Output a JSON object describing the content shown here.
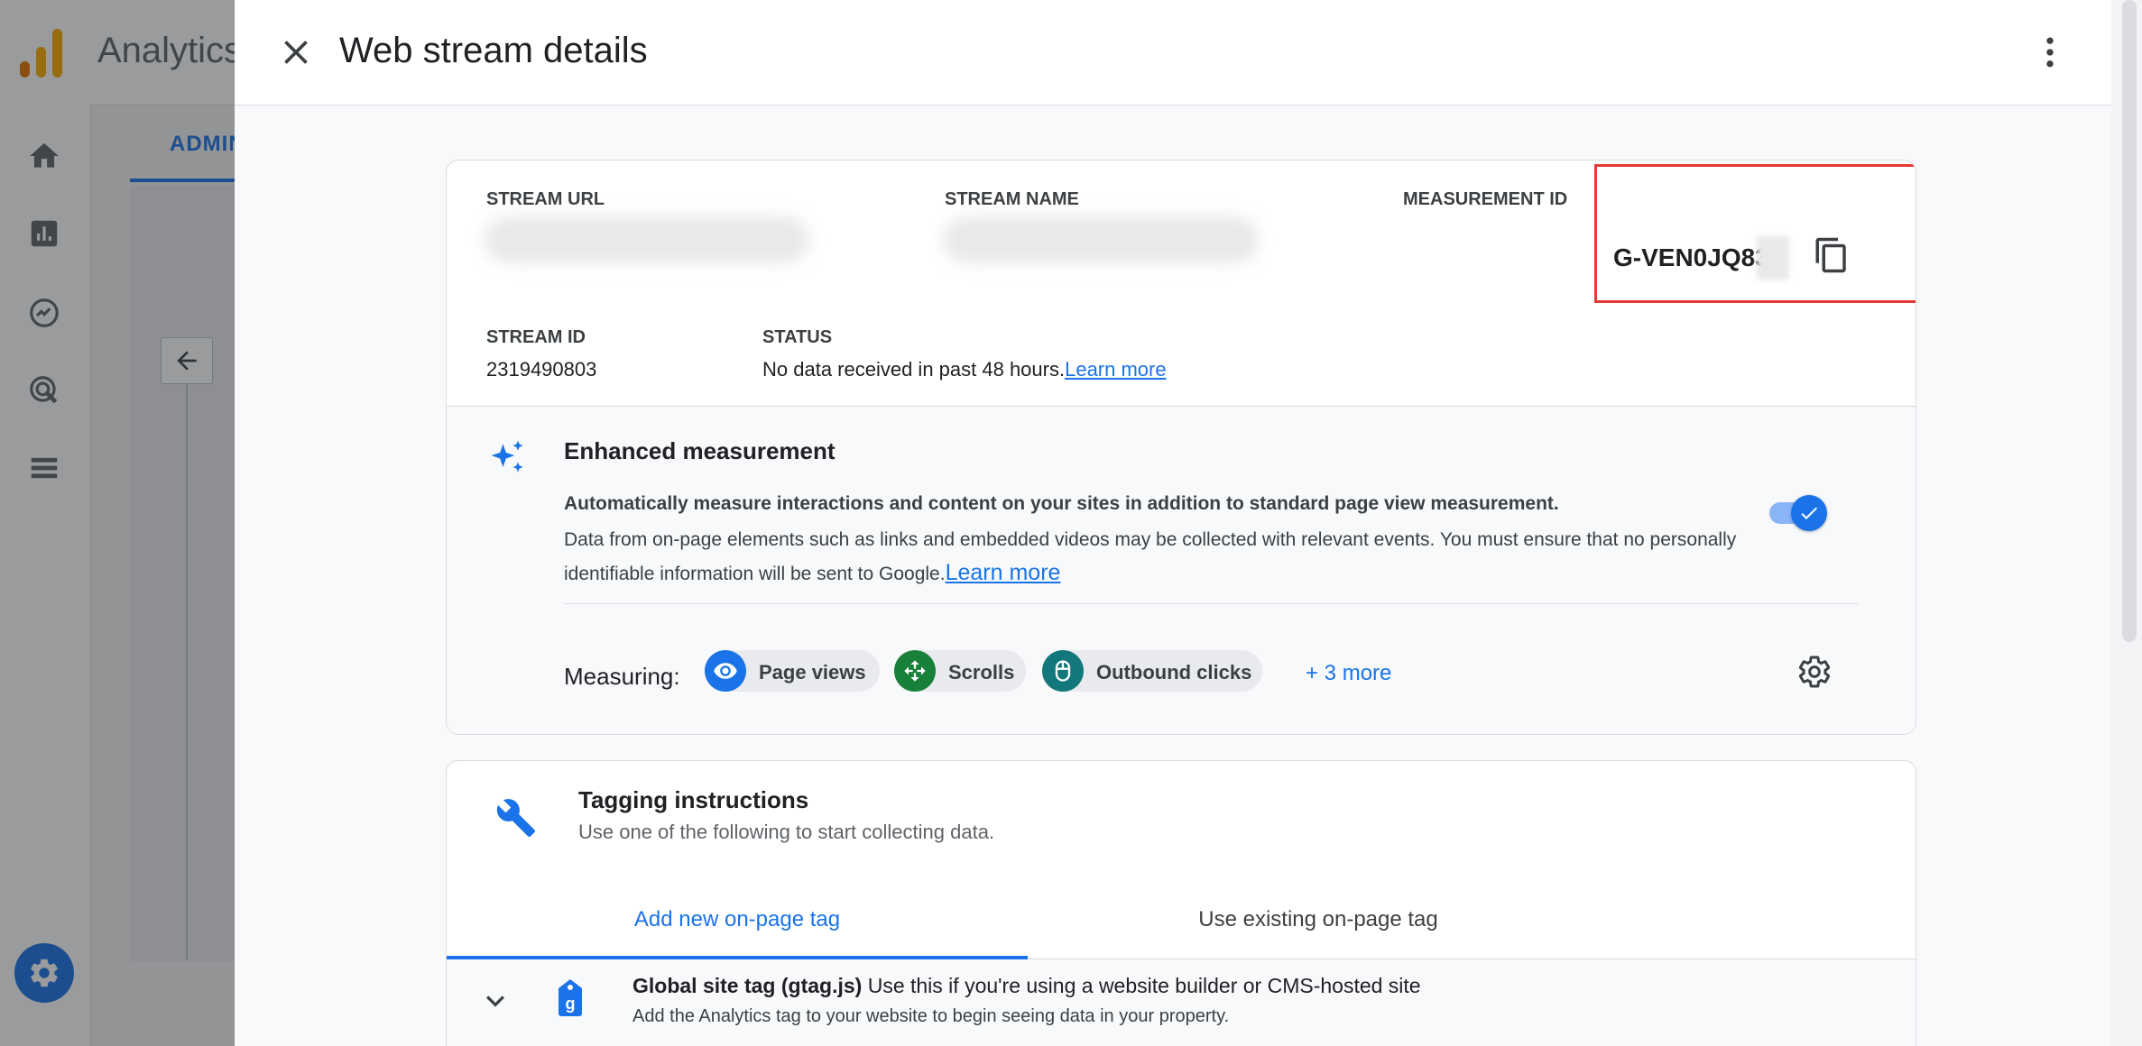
{
  "background": {
    "app_title": "Analytics",
    "admin_tab": "ADMIN"
  },
  "drawer": {
    "title": "Web stream details",
    "close_icon": "close-icon",
    "more_icon": "more-vert-icon"
  },
  "stream": {
    "url_label": "STREAM URL",
    "name_label": "STREAM NAME",
    "measurement_id_label": "MEASUREMENT ID",
    "measurement_id_value": "G-VEN0JQ83",
    "stream_id_label": "STREAM ID",
    "stream_id_value": "2319490803",
    "status_label": "STATUS",
    "status_value": "No data received in past 48 hours.",
    "status_link": "Learn more"
  },
  "enhanced": {
    "title": "Enhanced measurement",
    "desc_bold": "Automatically measure interactions and content on your sites in addition to standard page view measurement.",
    "desc": "Data from on-page elements such as links and embedded videos may be collected with relevant events. You must ensure that no personally identifiable information will be sent to Google.",
    "desc_link": "Learn more",
    "toggle_on": true,
    "measuring_label": "Measuring:",
    "chips": [
      {
        "label": "Page views",
        "color": "#1a73e8",
        "icon": "eye-icon"
      },
      {
        "label": "Scrolls",
        "color": "#188038",
        "icon": "scroll-icon"
      },
      {
        "label": "Outbound clicks",
        "color": "#12787c",
        "icon": "mouse-icon"
      }
    ],
    "more_label": "+ 3 more"
  },
  "tagging": {
    "title": "Tagging instructions",
    "subtitle": "Use one of the following to start collecting data.",
    "tabs": [
      {
        "label": "Add new on-page tag",
        "active": true
      },
      {
        "label": "Use existing on-page tag",
        "active": false
      }
    ],
    "gtag_title": "Global site tag (gtag.js)",
    "gtag_title_rest": "Use this if you're using a website builder or CMS-hosted site",
    "gtag_sub": "Add the Analytics tag to your website to begin seeing data in your property."
  },
  "colors": {
    "accent": "#1a73e8",
    "highlight_box": "#e53935"
  }
}
